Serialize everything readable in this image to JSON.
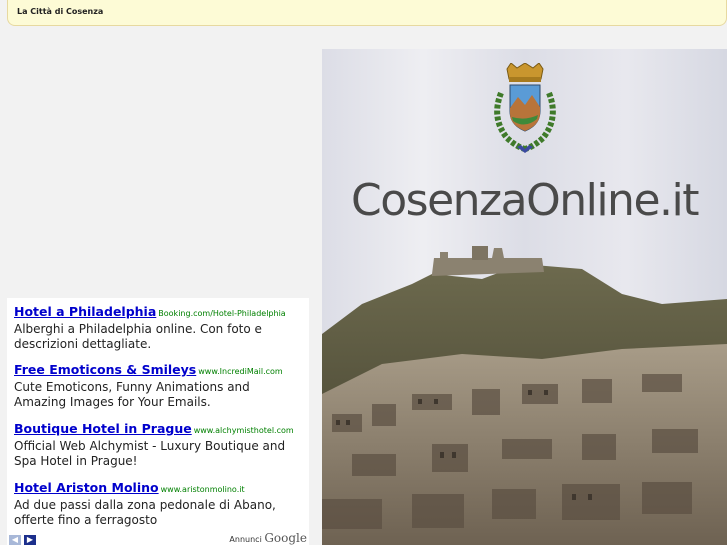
{
  "header": {
    "title": "La Città di Cosenza"
  },
  "hero": {
    "logo_text": "CosenzaOnline.it"
  },
  "ads": [
    {
      "title": "Hotel a Philadelphia",
      "url": "Booking.com/Hotel-Philadelphia",
      "desc": "Alberghi a Philadelphia online. Con foto e descrizioni dettagliate."
    },
    {
      "title": "Free Emoticons & Smileys",
      "url": "www.IncrediMail.com",
      "desc": "Cute Emoticons, Funny Animations and Amazing Images for Your Emails."
    },
    {
      "title": "Boutique Hotel in Prague",
      "url": "www.alchymisthotel.com",
      "desc": "Official Web Alchymist - Luxury Boutique and Spa Hotel in Prague!"
    },
    {
      "title": "Hotel Ariston Molino",
      "url": "www.aristonmolino.it",
      "desc": "Ad due passi dalla zona pedonale di Abano, offerte fino a ferragosto"
    }
  ],
  "ad_footer": {
    "annunci_label": "Annunci",
    "google_label": "Google",
    "prev_label": "◀",
    "next_label": "▶"
  }
}
